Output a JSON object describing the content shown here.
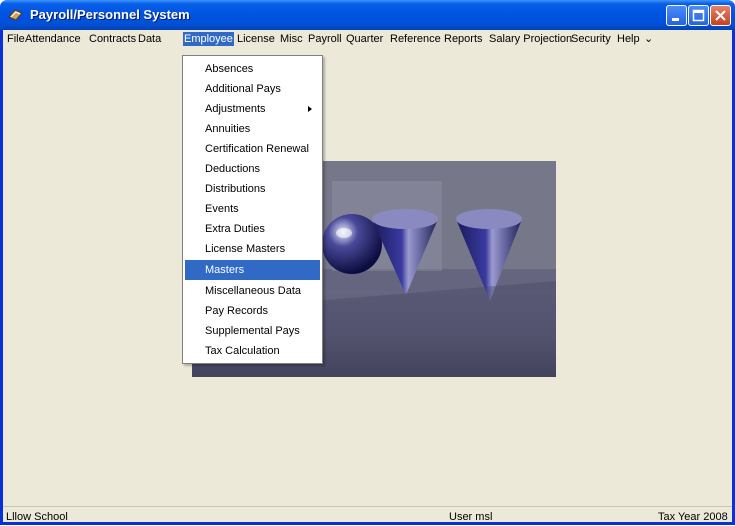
{
  "window": {
    "title": "Payroll/Personnel System"
  },
  "menubar": {
    "items": [
      "File",
      "Attendance",
      "Contracts",
      "Data",
      "Employee",
      "License",
      "Misc",
      "Payroll",
      "Quarter",
      "Reference",
      "Reports",
      "Salary Projection",
      "Security",
      "Help"
    ],
    "overflow": "⌄",
    "active": "Employee"
  },
  "employee_menu": {
    "items": [
      "Absences",
      "Additional Pays",
      "Adjustments",
      "Annuities",
      "Certification Renewal",
      "Deductions",
      "Distributions",
      "Events",
      "Extra Duties",
      "License Masters",
      "Masters",
      "Miscellaneous Data",
      "Pay Records",
      "Supplemental Pays",
      "Tax Calculation"
    ],
    "highlighted": "Masters",
    "has_submenu": "Adjustments"
  },
  "statusbar": {
    "school": "Lllow School",
    "user": "User msl",
    "tax_year": "Tax Year 2008"
  },
  "colors": {
    "title_blue": "#0054e3",
    "highlight": "#316ac5",
    "face": "#ece9d8"
  }
}
